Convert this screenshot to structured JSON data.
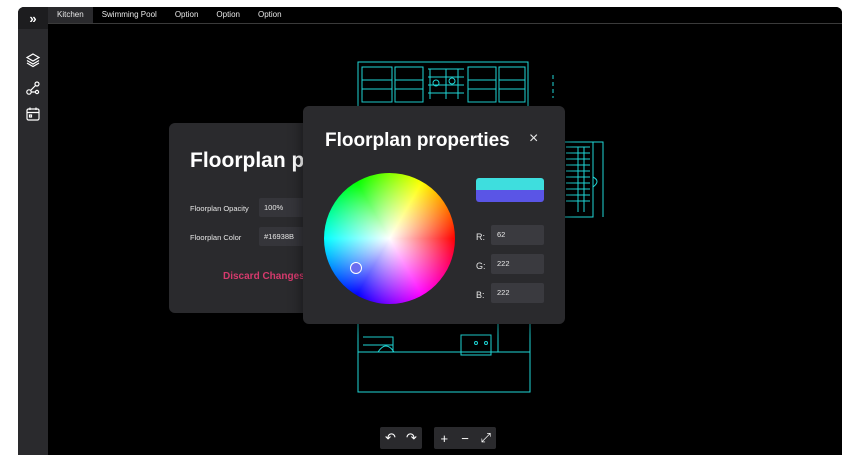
{
  "sidebar": {
    "expand_glyph": "»",
    "icons": [
      "layers-icon",
      "nodes-icon",
      "calendar-icon"
    ]
  },
  "tabs": [
    {
      "label": "Kitchen",
      "active": true
    },
    {
      "label": "Swimming Pool",
      "active": false
    },
    {
      "label": "Option",
      "active": false
    },
    {
      "label": "Option",
      "active": false
    },
    {
      "label": "Option",
      "active": false
    }
  ],
  "back_panel": {
    "title": "Floorplan properties",
    "opacity_label": "Floorplan Opacity",
    "opacity_value": "100%",
    "color_label": "Floorplan Color",
    "color_value": "#16938B",
    "discard_label": "Discard Changes"
  },
  "color_panel": {
    "title": "Floorplan properties",
    "close_glyph": "×",
    "swatch_new": "#3EDEDE",
    "swatch_old": "#5A55E6",
    "r_label": "R:",
    "r_value": "62",
    "g_label": "G:",
    "g_value": "222",
    "b_label": "B:",
    "b_value": "222"
  },
  "toolbar": {
    "undo_glyph": "↶",
    "redo_glyph": "↷",
    "zoom_in_glyph": "+",
    "zoom_out_glyph": "−",
    "fit_glyph": "⤢"
  },
  "colors": {
    "floorplan_line": "#1fd6d6",
    "panel_bg": "#2a2a2d",
    "discard": "#d63a6d"
  }
}
